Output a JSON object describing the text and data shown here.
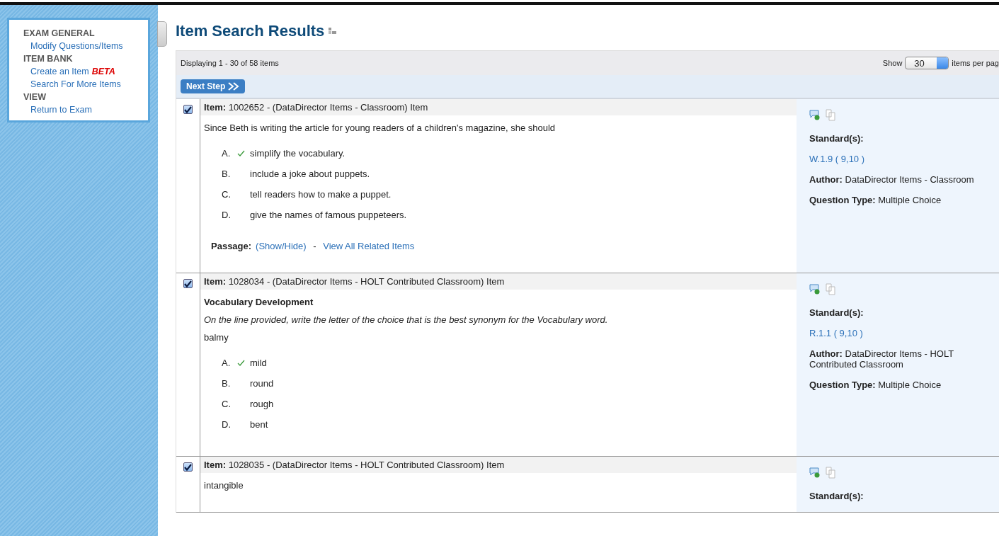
{
  "sidebar": {
    "sections": [
      {
        "title": "EXAM GENERAL",
        "links": [
          {
            "label": "Modify Questions/Items"
          }
        ]
      },
      {
        "title": "ITEM BANK",
        "links": [
          {
            "label": "Create an Item",
            "badge": "BETA"
          },
          {
            "label": "Search For More Items"
          }
        ]
      },
      {
        "title": "VIEW",
        "links": [
          {
            "label": "Return to Exam"
          }
        ]
      }
    ]
  },
  "page": {
    "title": "Item Search Results"
  },
  "results": {
    "displaying": "Displaying 1 - 30 of 58 items",
    "show_label": "Show",
    "per_page": "30",
    "per_page_suffix": "items per pag",
    "next_button": "Next Step",
    "items": [
      {
        "checked": true,
        "title": "**Item:** 1002652 - (DataDirector Items - Classroom) Item",
        "stem": "Since Beth is writing the article for young readers of a children's magazine, she should",
        "options": [
          {
            "letter": "A.",
            "text": "simplify the vocabulary.",
            "correct": true
          },
          {
            "letter": "B.",
            "text": "include a joke about puppets.",
            "correct": false
          },
          {
            "letter": "C.",
            "text": "tell readers how to make a puppet.",
            "correct": false
          },
          {
            "letter": "D.",
            "text": "give the names of famous puppeteers.",
            "correct": false
          }
        ],
        "passage": {
          "label": "Passage:",
          "toggle": "(Show/Hide)",
          "separator": "-",
          "link": "View All Related Items"
        },
        "side": {
          "standards_label": "Standard(s):",
          "standard": "W.1.9 ( 9,10 )",
          "author": "**Author:** DataDirector Items - Classroom",
          "question_type": "**Question Type:** Multiple Choice"
        }
      },
      {
        "checked": true,
        "title": "**Item:** 1028034 - (DataDirector Items - HOLT Contributed Classroom) Item",
        "heading": "Vocabulary Development",
        "instruction": "On the line provided, write the letter of the choice that is the best synonym for the Vocabulary word.",
        "stem": "balmy",
        "options": [
          {
            "letter": "A.",
            "text": "mild",
            "correct": true
          },
          {
            "letter": "B.",
            "text": "round",
            "correct": false
          },
          {
            "letter": "C.",
            "text": "rough",
            "correct": false
          },
          {
            "letter": "D.",
            "text": "bent",
            "correct": false
          }
        ],
        "side": {
          "standards_label": "Standard(s):",
          "standard": "R.1.1 ( 9,10 )",
          "author": "**Author:** DataDirector Items - HOLT Contributed Classroom",
          "question_type": "**Question Type:** Multiple Choice"
        }
      },
      {
        "checked": true,
        "title": "**Item:** 1028035 - (DataDirector Items - HOLT Contributed Classroom) Item",
        "stem": "intangible",
        "side": {
          "standards_label": "Standard(s):"
        }
      }
    ]
  }
}
